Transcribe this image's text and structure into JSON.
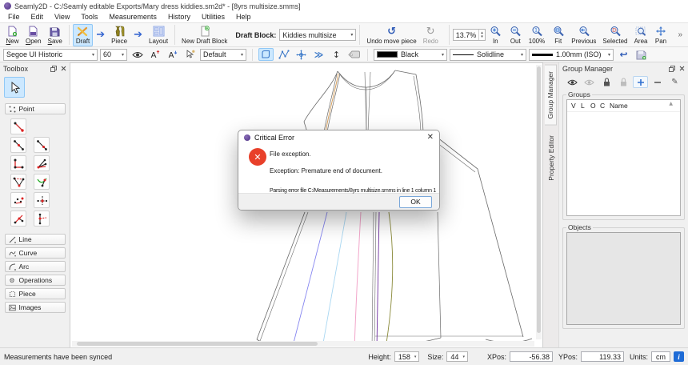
{
  "window": {
    "title": "Seamly2D - C:/Seamly editable Exports/Mary dress kiddies.sm2d* - [8yrs multisize.smms]"
  },
  "menu": {
    "items": [
      "File",
      "Edit",
      "View",
      "Tools",
      "Measurements",
      "History",
      "Utilities",
      "Help"
    ]
  },
  "toolbar1": {
    "new_label": "New",
    "open_label": "Open",
    "save_label": "Save",
    "draft_label": "Draft",
    "piece_label": "Piece",
    "layout_label": "Layout",
    "new_draft_block_label": "New Draft Block",
    "draft_block_label": "Draft Block:",
    "draft_block_value": "Kiddies multisize",
    "undo_label": "Undo move piece",
    "redo_label": "Redo",
    "zoom_value": "13.7%",
    "zoom_tools": [
      {
        "label": "In"
      },
      {
        "label": "Out"
      },
      {
        "label": "100%"
      },
      {
        "label": "Fit"
      },
      {
        "label": "Previous"
      },
      {
        "label": "Selected"
      },
      {
        "label": "Area"
      },
      {
        "label": "Pan"
      }
    ],
    "overflow": "»"
  },
  "toolbar2": {
    "font_value": "Segoe UI Historic",
    "font_size_value": "60",
    "style_value": "Default",
    "color_value": "Black",
    "line_type_value": "Solidline",
    "line_weight_value": "1.00mm (ISO)"
  },
  "toolbox": {
    "title": "Toolbox",
    "sections": [
      "Point",
      "Line",
      "Curve",
      "Arc",
      "Operations",
      "Piece",
      "Images"
    ]
  },
  "dialog": {
    "title": "Critical Error",
    "line1": "File exception.",
    "line2": "Exception: Premature end of document.",
    "line3": "Parsing error file C:/Measurements/8yrs multisize.smms in line 1 column 1",
    "ok_label": "OK"
  },
  "group_manager": {
    "tab_group_manager": "Group Manager",
    "tab_property_editor": "Property Editor",
    "title": "Group Manager",
    "groups_label": "Groups",
    "columns": [
      "V",
      "L",
      "O",
      "C",
      "Name"
    ],
    "objects_label": "Objects"
  },
  "statusbar": {
    "message": "Measurements have been synced",
    "height_label": "Height:",
    "height_value": "158",
    "size_label": "Size:",
    "size_value": "44",
    "xpos_label": "XPos:",
    "xpos_value": "-56.38",
    "ypos_label": "YPos:",
    "ypos_value": "119.33",
    "units_label": "Units:",
    "units_value": "cm"
  },
  "colors": {
    "selection_highlight": "#cce8ff",
    "selection_border": "#90c8f6",
    "error_red": "#e8402a",
    "accent_blue": "#3465d0"
  }
}
